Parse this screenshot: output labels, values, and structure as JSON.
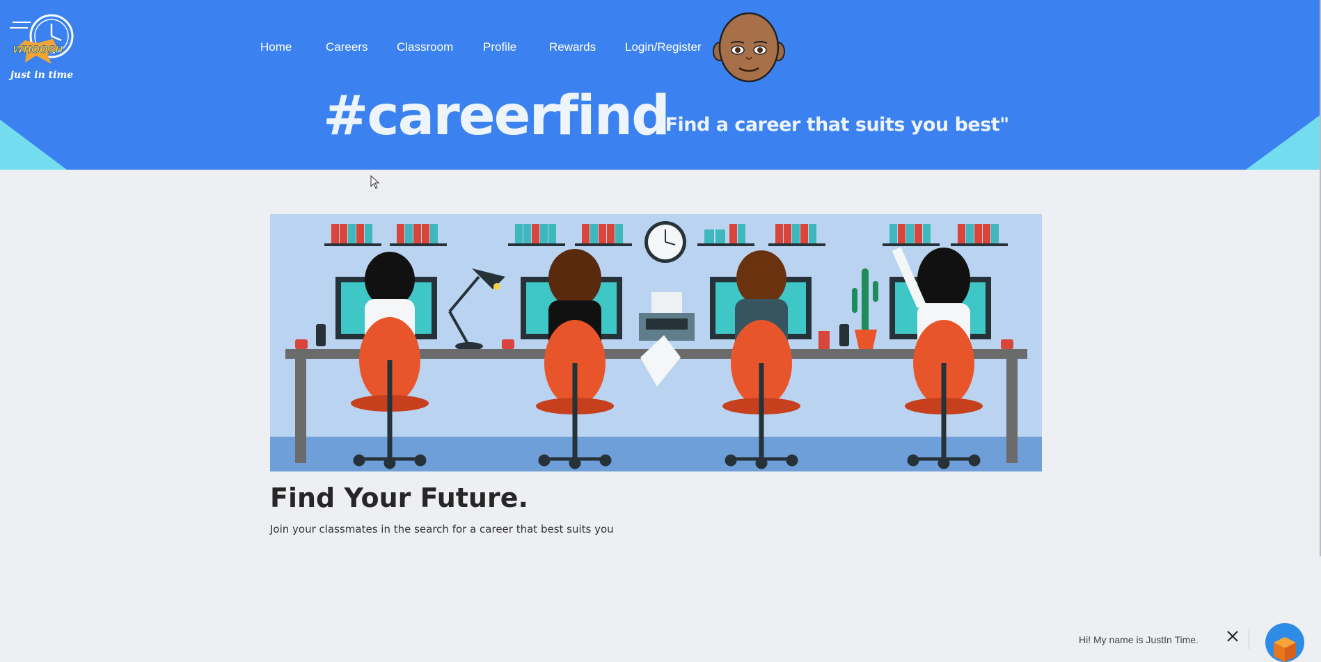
{
  "logo": {
    "tagline": "just in time",
    "text": "WHOOSH"
  },
  "nav": {
    "items": [
      {
        "label": "Home"
      },
      {
        "label": "Careers"
      },
      {
        "label": "Classroom"
      },
      {
        "label": "Profile"
      },
      {
        "label": "Rewards"
      },
      {
        "label": "Login/Register"
      }
    ]
  },
  "hero": {
    "hashtag": "#careerfind",
    "tagline": "\"Find a career that suits you best\""
  },
  "main": {
    "headline": "Find Your Future.",
    "subline": "Join your classmates in the search for a career that best suits you"
  },
  "chat": {
    "greeting": "Hi! My name is JustIn Time."
  },
  "colors": {
    "header": "#3b82f0",
    "accent_triangles": "#74dcef",
    "page_background": "#edeff2",
    "chair": "#e8552b"
  },
  "icons": [
    "clock-logo-icon",
    "avatar-face-icon",
    "close-icon",
    "chatbot-icon",
    "cursor-icon"
  ]
}
